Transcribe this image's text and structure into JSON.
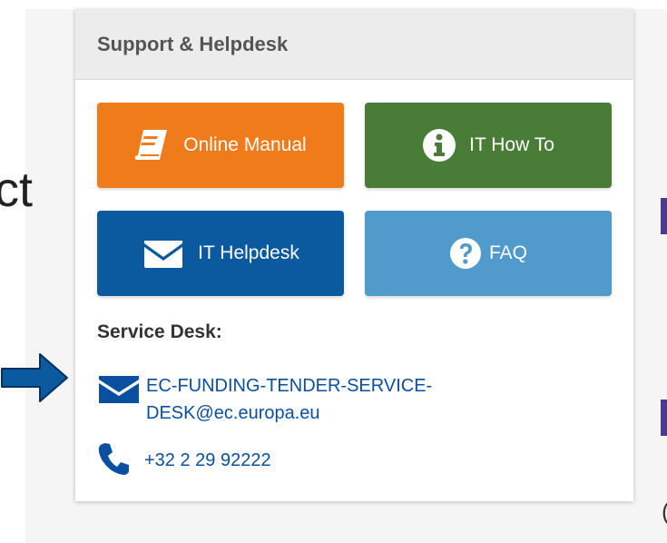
{
  "background": {
    "partial_text": "ct",
    "arrow_color": "#0b5a9f"
  },
  "card": {
    "title": "Support & Helpdesk",
    "buttons": [
      {
        "label": "Online Manual",
        "icon": "book-icon",
        "color": "#ef7b1b"
      },
      {
        "label": "IT How To",
        "icon": "info-circle-icon",
        "color": "#487c37"
      },
      {
        "label": "IT Helpdesk",
        "icon": "envelope-icon",
        "color": "#0b5a9f"
      },
      {
        "label": "FAQ",
        "icon": "question-circle-icon",
        "color": "#509bcb"
      }
    ],
    "service_desk": {
      "label": "Service Desk:",
      "email": "EC-FUNDING-TENDER-SERVICE-DESK@ec.europa.eu",
      "phone": "+32 2 29 92222",
      "link_color": "#0b4fa0"
    }
  }
}
